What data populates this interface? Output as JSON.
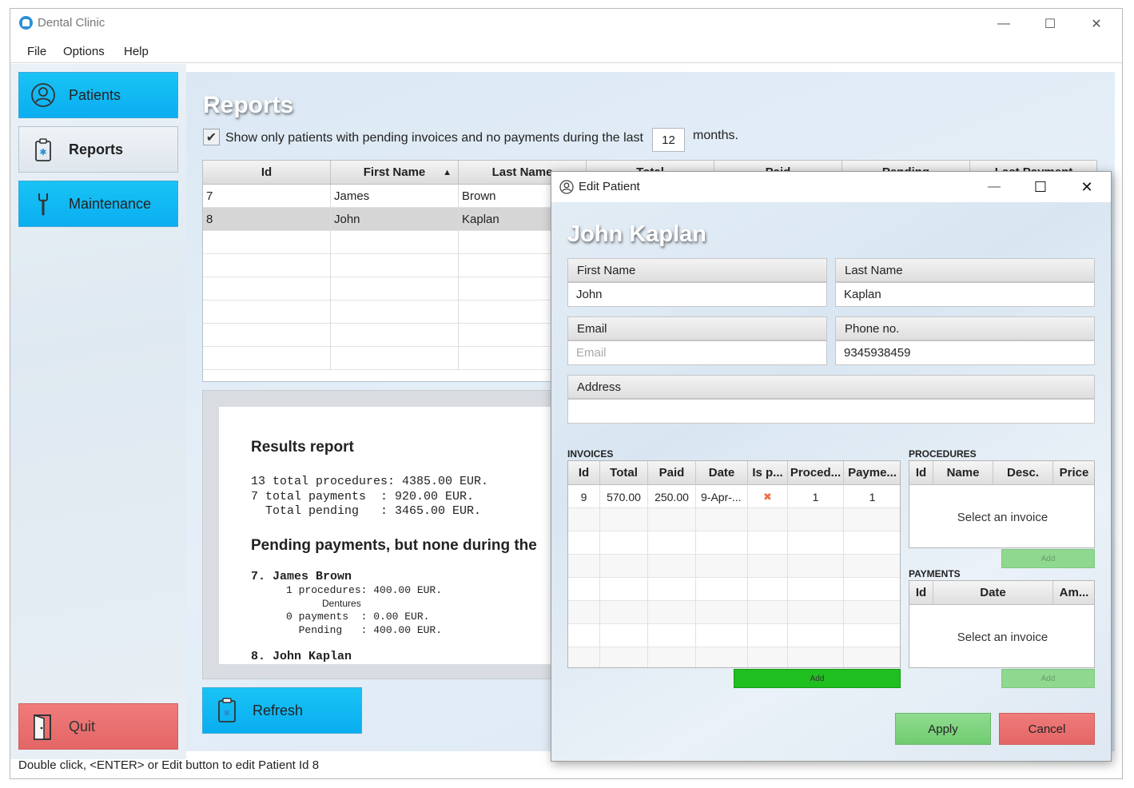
{
  "window": {
    "title": "Dental Clinic",
    "minimize": "—",
    "maximize": "☐",
    "close": "✕"
  },
  "menu": [
    "File",
    "Options",
    "Help"
  ],
  "sidebar": {
    "patients": "Patients",
    "reports": "Reports",
    "maintenance": "Maintenance",
    "quit": "Quit"
  },
  "reports": {
    "title": "Reports",
    "filter_checked": true,
    "filter_text": "Show only patients with pending invoices and no payments during the last",
    "months_value": "12",
    "months_label": "months.",
    "columns": [
      "Id",
      "First Name",
      "Last Name",
      "Total",
      "Paid",
      "Pending",
      "Last Payment"
    ],
    "sort_indicator": "▲",
    "rows": [
      {
        "id": "7",
        "first": "James",
        "last": "Brown"
      },
      {
        "id": "8",
        "first": "John",
        "last": "Kaplan"
      }
    ],
    "selected_row": 1,
    "report": {
      "heading1": "Results report",
      "summary": "13 total procedures: 4385.00 EUR.\n7 total payments  : 920.00 EUR.\n  Total pending   : 3465.00 EUR.",
      "heading2": "Pending payments, but none during the",
      "p1_name": "7. James Brown",
      "p1_proc": "1 procedures: 400.00 EUR.",
      "p1_proc_item": "Dentures",
      "p1_pay": "0 payments  : 0.00 EUR.\n  Pending   : 400.00 EUR.",
      "p2_name": "8. John Kaplan"
    },
    "refresh": "Refresh"
  },
  "status_bar": "Double click, <ENTER> or Edit button to edit Patient Id 8",
  "dialog": {
    "title": "Edit Patient",
    "patient_name": "John Kaplan",
    "first_name_label": "First Name",
    "first_name_value": "John",
    "last_name_label": "Last Name",
    "last_name_value": "Kaplan",
    "email_label": "Email",
    "email_placeholder": "Email",
    "phone_label": "Phone no.",
    "phone_value": "9345938459",
    "address_label": "Address",
    "address_value": "",
    "invoices": {
      "label": "INVOICES",
      "columns": [
        "Id",
        "Total",
        "Paid",
        "Date",
        "Is p...",
        "Proced...",
        "Payme..."
      ],
      "rows": [
        {
          "id": "9",
          "total": "570.00",
          "paid": "250.00",
          "date": "9-Apr-...",
          "is_paid": "✖",
          "procedures": "1",
          "payments": "1"
        }
      ],
      "add": "Add"
    },
    "procedures": {
      "label": "PROCEDURES",
      "columns": [
        "Id",
        "Name",
        "Desc.",
        "Price"
      ],
      "empty": "Select an invoice",
      "add": "Add"
    },
    "payments": {
      "label": "PAYMENTS",
      "columns": [
        "Id",
        "Date",
        "Am..."
      ],
      "empty": "Select an invoice",
      "add": "Add"
    },
    "apply": "Apply",
    "cancel": "Cancel"
  },
  "colors": {
    "accent_blue": "#0aaef0",
    "quit_red": "#e46666",
    "add_green": "#22bb22",
    "apply_green": "#7fd47f",
    "cancel_red": "#e46666",
    "unpaid_mark": "#f07040"
  }
}
